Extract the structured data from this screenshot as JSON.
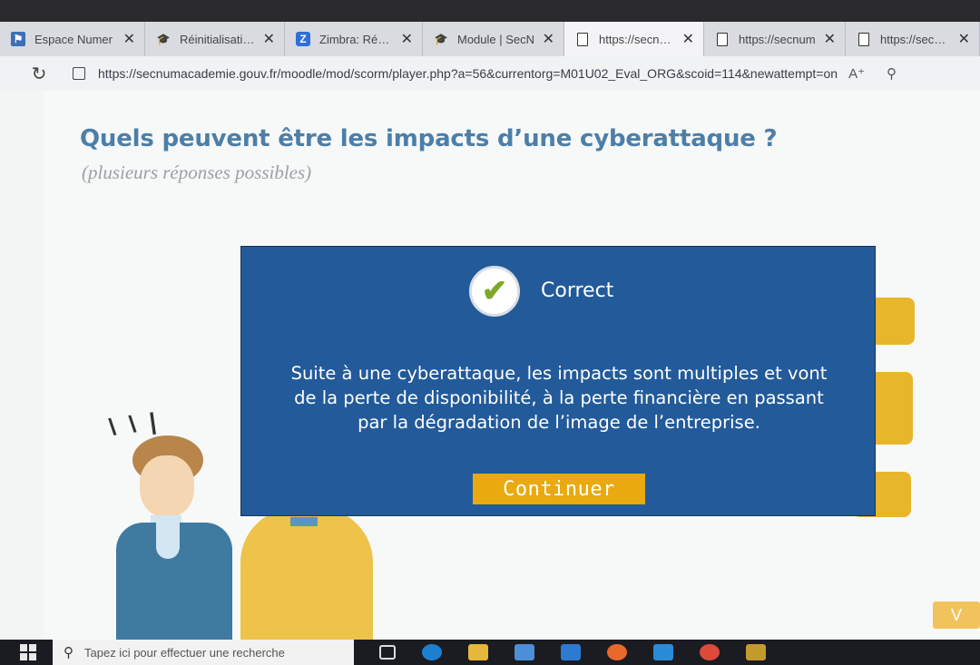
{
  "browser": {
    "tabs": [
      {
        "label": "Espace Numer",
        "icon": "moodle-flag-icon",
        "active": false
      },
      {
        "label": "Réinitialisation",
        "icon": "graduation-cap-icon",
        "active": false
      },
      {
        "label": "Zimbra: Récept",
        "icon": "zimbra-icon",
        "active": false
      },
      {
        "label": "Module | SecN",
        "icon": "graduation-cap-icon",
        "active": false
      },
      {
        "label": "https://secnum",
        "icon": "document-icon",
        "active": true
      },
      {
        "label": "https://secnum",
        "icon": "document-icon",
        "active": false
      },
      {
        "label": "https://secnum",
        "icon": "document-icon",
        "active": false
      }
    ],
    "close_glyph": "✕",
    "url": "https://secnumacademie.gouv.fr/moodle/mod/scorm/player.php?a=56&currentorg=M01U02_Eval_ORG&scoid=114&newattempt=on"
  },
  "page": {
    "question": "Quels peuvent être les impacts d’une cyberattaque ?",
    "subtitle": "(plusieurs réponses possibles)"
  },
  "modal": {
    "status": "Correct",
    "feedback_lines": [
      "Suite à une cyberattaque, les impacts sont multiples et vont",
      "de la perte de disponibilité, à la perte financière en passant",
      "par la dégradation de l’image de l’entreprise."
    ],
    "continue_label": "Continuer"
  },
  "nav": {
    "next_label": "V"
  },
  "taskbar": {
    "search_placeholder": "Tapez ici pour effectuer une recherche"
  },
  "colors": {
    "modal_bg": "#235a99",
    "accent_yellow": "#e9a90f",
    "question_blue": "#4c7fa8",
    "check_green": "#7ea82b"
  }
}
